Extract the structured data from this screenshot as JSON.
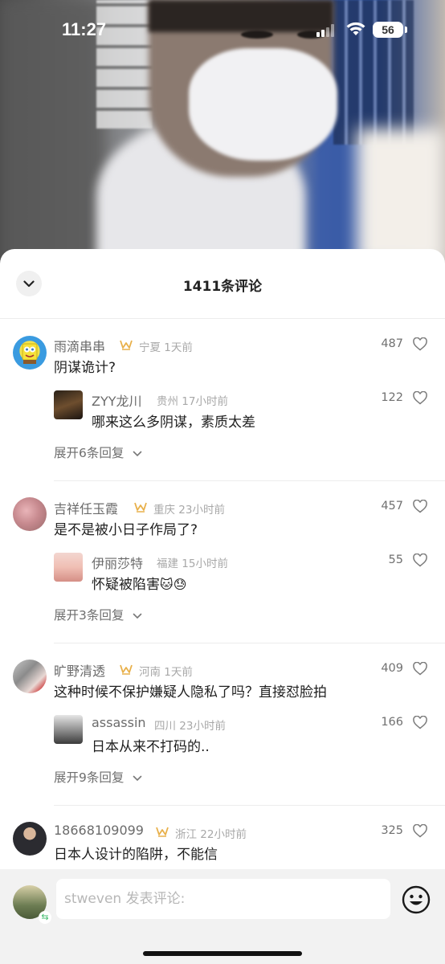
{
  "status_bar": {
    "time": "11:27",
    "battery": "56"
  },
  "sheet": {
    "title": "1411条评论"
  },
  "threads": [
    {
      "name": "雨滴串串",
      "meta": "宁夏 1天前",
      "text": "阴谋诡计?",
      "likes": "487",
      "reply": {
        "name": "ZYY龙川",
        "meta": "贵州 17小时前",
        "text": "哪来这么多阴谋，素质太差",
        "likes": "122"
      },
      "expand": "展开6条回复"
    },
    {
      "name": "吉祥任玉霞",
      "meta": "重庆 23小时前",
      "text": "是不是被小日子作局了?",
      "likes": "457",
      "reply": {
        "name": "伊丽莎特",
        "meta": "福建 15小时前",
        "text": "怀疑被陷害",
        "likes": "55"
      },
      "expand": "展开3条回复"
    },
    {
      "name": "旷野清透",
      "meta": "河南 1天前",
      "text": "这种时候不保护嫌疑人隐私了吗？直接怼脸拍",
      "likes": "409",
      "reply": {
        "name": "assassin",
        "meta": "四川 23小时前",
        "text": "日本从来不打码的..",
        "likes": "166"
      },
      "expand": "展开9条回复"
    },
    {
      "name": "18668109099",
      "meta": "浙江 22小时前",
      "text": "日本人设计的陷阱，不能信",
      "likes": "325"
    }
  ],
  "input": {
    "placeholder": "stweven 发表评论:"
  },
  "icons": {
    "collapse": "chevron-down-icon",
    "heart": "heart-outline-icon",
    "crown": "crown-badge-icon",
    "emoji": "smiley-icon",
    "expand": "chevron-down-icon",
    "swap": "swap-icon"
  }
}
